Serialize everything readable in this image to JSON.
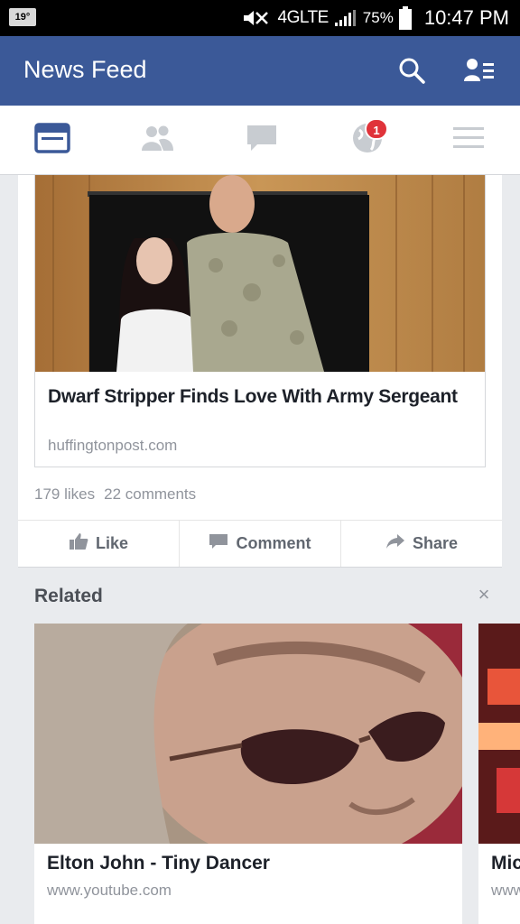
{
  "status_bar": {
    "temperature": "19°",
    "network": "4GLTE",
    "battery": "75%",
    "time": "10:47 PM"
  },
  "app_bar": {
    "title": "News Feed",
    "search_icon": "search-icon",
    "friend_requests_icon": "friend-requests-icon",
    "color": "#3b5998"
  },
  "tabs": [
    {
      "name": "news-feed",
      "icon": "newsfeed-icon",
      "active": true
    },
    {
      "name": "friends",
      "icon": "friends-icon",
      "active": false
    },
    {
      "name": "messages",
      "icon": "messages-icon",
      "active": false
    },
    {
      "name": "notifications",
      "icon": "globe-icon",
      "active": false,
      "badge": "1"
    },
    {
      "name": "more",
      "icon": "menu-icon",
      "active": false
    }
  ],
  "post": {
    "link_title": "Dwarf Stripper Finds Love With Army Sergeant",
    "link_domain": "huffingtonpost.com",
    "likes": "179 likes",
    "comments": "22 comments",
    "actions": {
      "like": "Like",
      "comment": "Comment",
      "share": "Share"
    }
  },
  "related": {
    "title": "Related",
    "close": "×",
    "items": [
      {
        "title": "Elton John - Tiny Dancer",
        "domain": "www.youtube.com"
      },
      {
        "title": "Mic",
        "domain": "www"
      }
    ]
  }
}
